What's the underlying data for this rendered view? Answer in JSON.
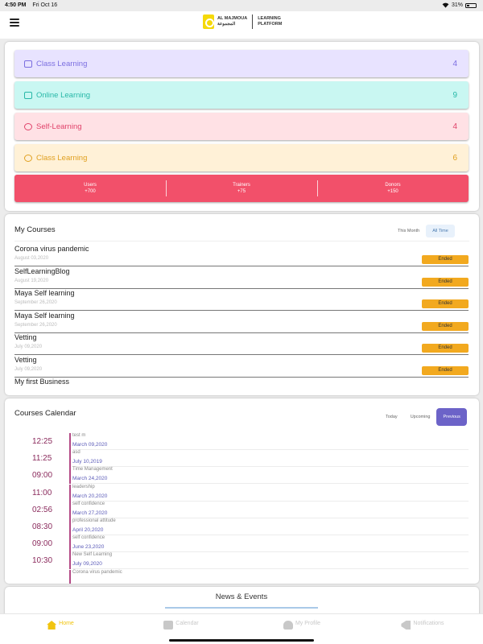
{
  "status_bar": {
    "time": "4:50 PM",
    "date": "Fri Oct 16",
    "battery": "31%"
  },
  "header": {
    "logo_en": "AL MAJMOUA",
    "logo_ar": "المجموعة",
    "logo_right_1": "LEARNING",
    "logo_right_2": "PLATFORM"
  },
  "learning_stats": [
    {
      "label": "Class Learning",
      "count": "4",
      "bg": "#e8e3ff",
      "fg": "#7b6ee0"
    },
    {
      "label": "Online Learning",
      "count": "9",
      "bg": "#c9f7f2",
      "fg": "#28b8a8"
    },
    {
      "label": "Self-Learning",
      "count": "4",
      "bg": "#ffe1e5",
      "fg": "#e0426a"
    },
    {
      "label": "Class Learning",
      "count": "6",
      "bg": "#fff1d7",
      "fg": "#e0a020"
    }
  ],
  "summary": [
    {
      "label": "Users",
      "value": "+700"
    },
    {
      "label": "Trainers",
      "value": "+75"
    },
    {
      "label": "Donors",
      "value": "+150"
    }
  ],
  "my_courses": {
    "title": "My Courses",
    "tabs": [
      "This Month",
      "All Time"
    ],
    "active_tab": "All Time",
    "items": [
      {
        "name": "Corona virus pandemic",
        "date": "August 03,2020",
        "status": "Ended"
      },
      {
        "name": "SelfLearningBlog",
        "date": "August 19,2020",
        "status": "Ended"
      },
      {
        "name": "Maya Self learning",
        "date": "September 26,2020",
        "status": "Ended"
      },
      {
        "name": "Maya Self learning",
        "date": "September 26,2020",
        "status": "Ended"
      },
      {
        "name": "Vetting",
        "date": "July 09,2020",
        "status": "Ended"
      },
      {
        "name": "Vetting",
        "date": "July 09,2020",
        "status": "Ended"
      },
      {
        "name": "My first Business",
        "date": "",
        "status": ""
      }
    ]
  },
  "calendar": {
    "title": "Courses Calendar",
    "tabs": [
      "Today",
      "Upcoming",
      "Previous"
    ],
    "active_tab": "Previous",
    "items": [
      {
        "time": "12:25",
        "title": "test m",
        "date": "March 09,2020"
      },
      {
        "time": "11:25",
        "title": "asd",
        "date": "July 10,2019"
      },
      {
        "time": "09:00",
        "title": "Time Management",
        "date": "March 24,2020"
      },
      {
        "time": "11:00",
        "title": "leadership",
        "date": "March 20,2020"
      },
      {
        "time": "02:56",
        "title": "self confidence",
        "date": "March 27,2020"
      },
      {
        "time": "08:30",
        "title": "professional attitude",
        "date": "April 20,2020"
      },
      {
        "time": "09:00",
        "title": "self confidence",
        "date": "June 23,2020"
      },
      {
        "time": "10:30",
        "title": "New Self Learning",
        "date": "July 09,2020"
      },
      {
        "time": "",
        "title": "Corona virus pandemic",
        "date": ""
      }
    ]
  },
  "news": {
    "title": "News & Events"
  },
  "tabbar": [
    {
      "label": "Home",
      "icon": "home-icon",
      "active": true
    },
    {
      "label": "Calendar",
      "icon": "calendar-icon",
      "active": false
    },
    {
      "label": "My Profile",
      "icon": "profile-icon",
      "active": false
    },
    {
      "label": "Notifications",
      "icon": "megaphone-icon",
      "active": false
    }
  ]
}
